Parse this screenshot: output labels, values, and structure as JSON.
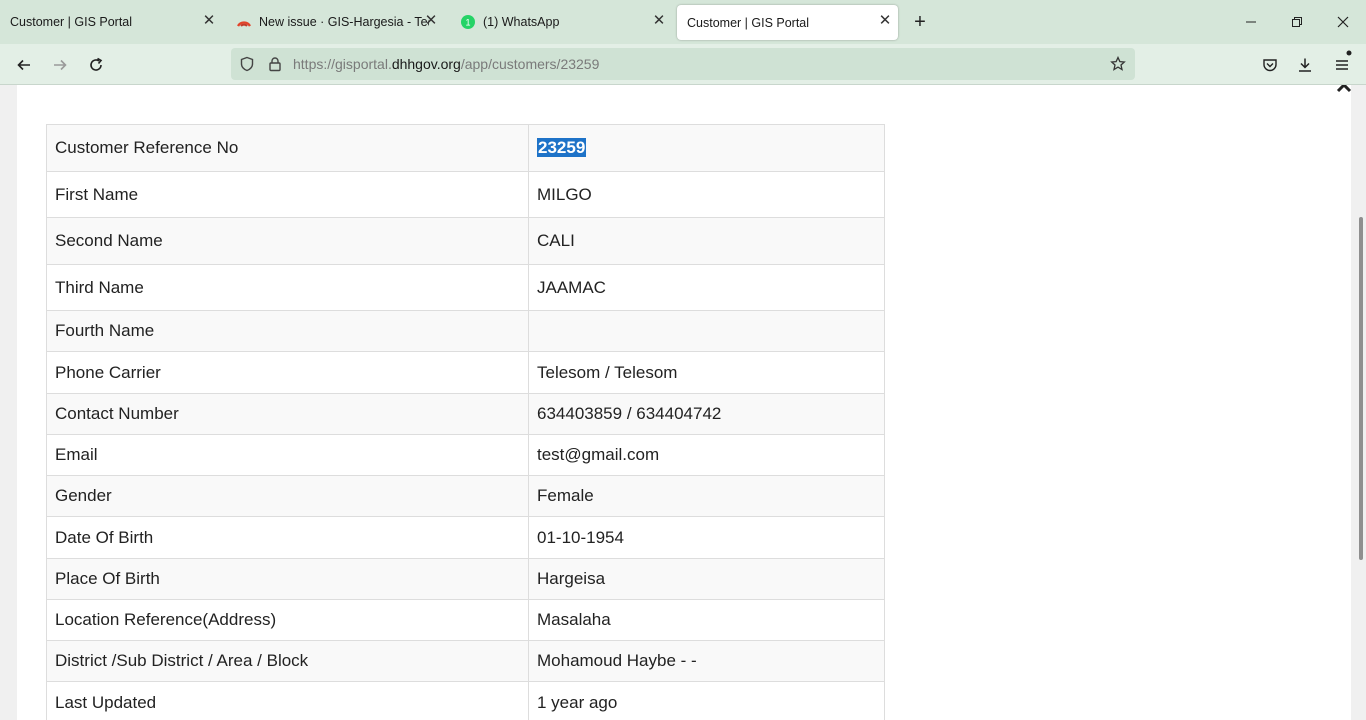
{
  "browser": {
    "tabs": [
      {
        "title": "Customer | GIS Portal",
        "active": false
      },
      {
        "title": "New issue · GIS-Hargesia - Team",
        "active": false
      },
      {
        "title": "(1) WhatsApp",
        "active": false,
        "badge": "1"
      },
      {
        "title": "Customer | GIS Portal",
        "active": true
      }
    ],
    "url": {
      "prefix": "https://gisportal.",
      "host": "dhhgov.org",
      "path": "/app/customers/23259"
    }
  },
  "customer": {
    "rows": [
      {
        "label": "Customer Reference No",
        "value": "23259"
      },
      {
        "label": "First Name",
        "value": "MILGO"
      },
      {
        "label": "Second Name",
        "value": "CALI"
      },
      {
        "label": "Third Name",
        "value": "JAAMAC"
      },
      {
        "label": "Fourth Name",
        "value": ""
      },
      {
        "label": "Phone Carrier",
        "value": "Telesom / Telesom"
      },
      {
        "label": "Contact Number",
        "value": "634403859 / 634404742"
      },
      {
        "label": "Email",
        "value": "test@gmail.com"
      },
      {
        "label": "Gender",
        "value": "Female"
      },
      {
        "label": "Date Of Birth",
        "value": "01-10-1954"
      },
      {
        "label": "Place Of Birth",
        "value": "Hargeisa"
      },
      {
        "label": "Location Reference(Address)",
        "value": "Masalaha"
      },
      {
        "label": "District /Sub District / Area / Block",
        "value": "Mohamoud Haybe - -"
      },
      {
        "label": "Last Updated",
        "value": "1 year ago"
      }
    ]
  },
  "colors": {
    "selection": "#1e73c8",
    "tabstrip": "#d5e6d9",
    "whatsapp": "#25d366"
  }
}
